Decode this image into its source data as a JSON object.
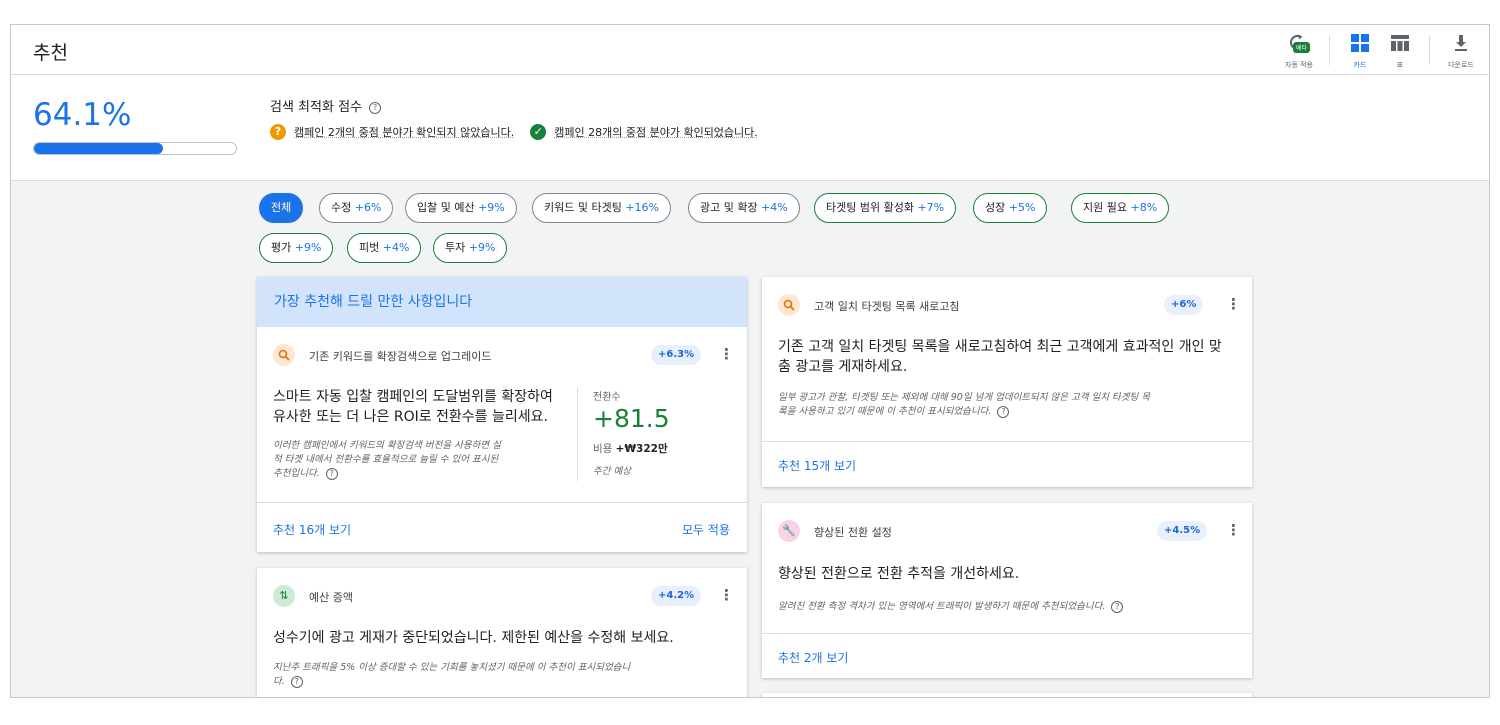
{
  "header": {
    "title": "추천",
    "auto_apply_label": "자동 적용",
    "beta_badge": "베타",
    "cards_label": "카드",
    "table_label": "표",
    "download_label": "다운로드"
  },
  "score": {
    "value": "64.1%",
    "progress_fraction": 0.641,
    "title": "검색 최적화 점수",
    "help_glyph": "?",
    "unconfirmed": "캠페인 2개의 중점 분야가 확인되지 않았습니다.",
    "confirmed": "캠페인 28개의 중점 분야가 확인되었습니다."
  },
  "chips": [
    {
      "label": "전체",
      "pct": ""
    },
    {
      "label": "수정",
      "pct": "+6%"
    },
    {
      "label": "입찰 및 예산",
      "pct": "+9%"
    },
    {
      "label": "키워드 및 타겟팅",
      "pct": "+16%"
    },
    {
      "label": "광고 및 확장",
      "pct": "+4%"
    },
    {
      "label": "타겟팅 범위 활성화",
      "pct": "+7%"
    },
    {
      "label": "성장",
      "pct": "+5%"
    },
    {
      "label": "지원 필요",
      "pct": "+8%"
    },
    {
      "label": "평가",
      "pct": "+9%"
    },
    {
      "label": "피벗",
      "pct": "+4%"
    },
    {
      "label": "투자",
      "pct": "+9%"
    }
  ],
  "top_card": {
    "banner": "가장 추천해 드릴 만한 사항입니다",
    "title": "기존 키워드를 확장검색으로 업그레이드",
    "badge": "+6.3%",
    "headline_1": "스마트 자동 입찰 캠페인의 도달범위를 확장하여",
    "headline_2": "유사한 또는 더 나은 ROI로 전환수를 늘리세요.",
    "desc_1": "이러한 캠페인에서 키워드의 확장검색 버전을 사용하면 실",
    "desc_2": "적 타겟 내에서 전환수를 효율적으로 늘릴 수 있어 표시된",
    "desc_3": "추천입니다.",
    "metric_label": "전환수",
    "metric_value": "+81.5",
    "cost_label": "비용",
    "cost_value": "+₩322만",
    "week": "주간 예상",
    "view_link": "추천 16개 보기",
    "apply_all": "모두 적용"
  },
  "budget_card": {
    "title": "예산 증액",
    "badge": "+4.2%",
    "headline": "성수기에 광고 게재가 중단되었습니다. 제한된 예산을 수정해 보세요.",
    "desc_1": "지난주 트래픽을 5% 이상 증대할 수 있는 기회를 놓치셨기 때문에 이 추천이 표시되었습니",
    "desc_2": "다."
  },
  "audience_card": {
    "title": "고객 일치 타겟팅 목록 새로고침",
    "badge": "+6%",
    "headline_1": "기존 고객 일치 타겟팅 목록을 새로고침하여 최근 고객에게 효과적인 개인 맞",
    "headline_2": "춤 광고를 게재하세요.",
    "desc_1": "일부 광고가 관찰, 타겟팅 또는 제외에 대해 90일 넘게 업데이트되지 않은 고객 일치 타겟팅 목",
    "desc_2": "록을 사용하고 있기 때문에 이 추천이 표시되었습니다.",
    "view_link": "추천 15개 보기"
  },
  "conversion_card": {
    "title": "향상된 전환 설정",
    "badge": "+4.5%",
    "headline": "향상된 전환으로 전환 추적을 개선하세요.",
    "desc": "알려진 전환 측정 격차가 있는 영역에서 트래픽이 발생하기 때문에 추천되었습니다.",
    "view_link": "추천 2개 보기"
  },
  "icons": {
    "auto_apply": "refresh-clock-icon",
    "cards": "grid-icon",
    "table": "table-icon",
    "download": "download-icon",
    "search": "search-icon",
    "budget": "budget-arrows-icon",
    "wrench": "wrench-icon",
    "more": "more-vert-icon"
  },
  "colors": {
    "accent": "#1a73e8",
    "green": "#188038",
    "warning": "#f29900",
    "banner_bg": "#d2e3fc"
  }
}
